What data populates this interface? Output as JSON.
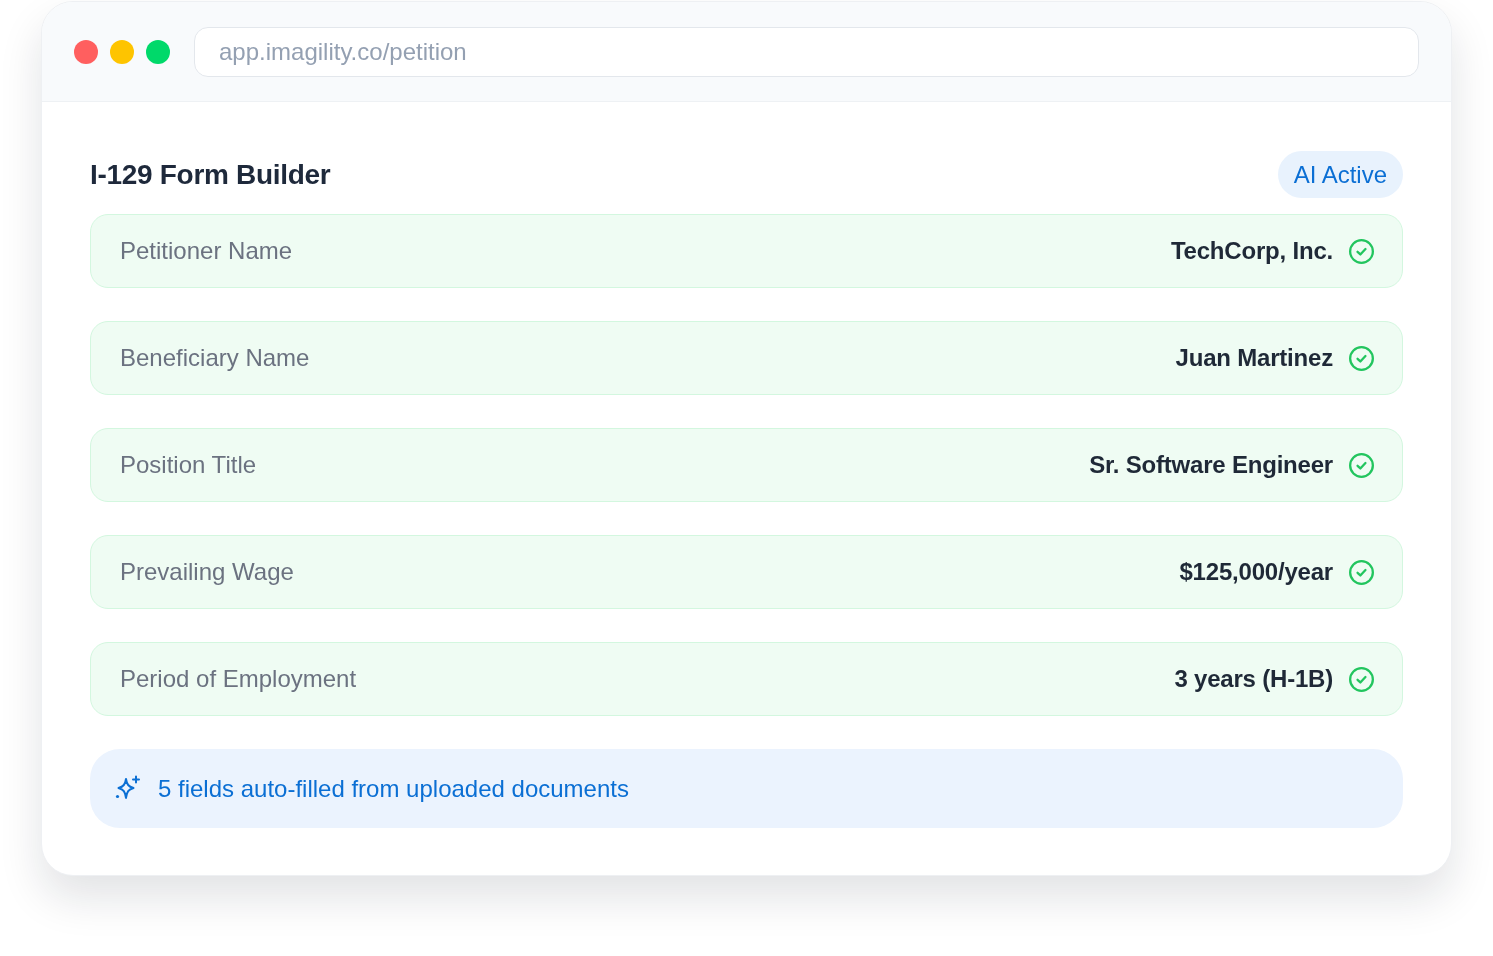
{
  "browser": {
    "url": "app.imagility.co/petition"
  },
  "form": {
    "title": "I-129 Form Builder",
    "badge": "AI Active",
    "fields": [
      {
        "label": "Petitioner Name",
        "value": "TechCorp, Inc.",
        "verified": true
      },
      {
        "label": "Beneficiary Name",
        "value": "Juan Martinez",
        "verified": true
      },
      {
        "label": "Position Title",
        "value": "Sr. Software Engineer",
        "verified": true
      },
      {
        "label": "Prevailing Wage",
        "value": "$125,000/year",
        "verified": true
      },
      {
        "label": "Period of Employment",
        "value": "3 years (H-1B)",
        "verified": true
      }
    ]
  },
  "notice": {
    "text": "5 fields auto-filled from uploaded documents"
  }
}
